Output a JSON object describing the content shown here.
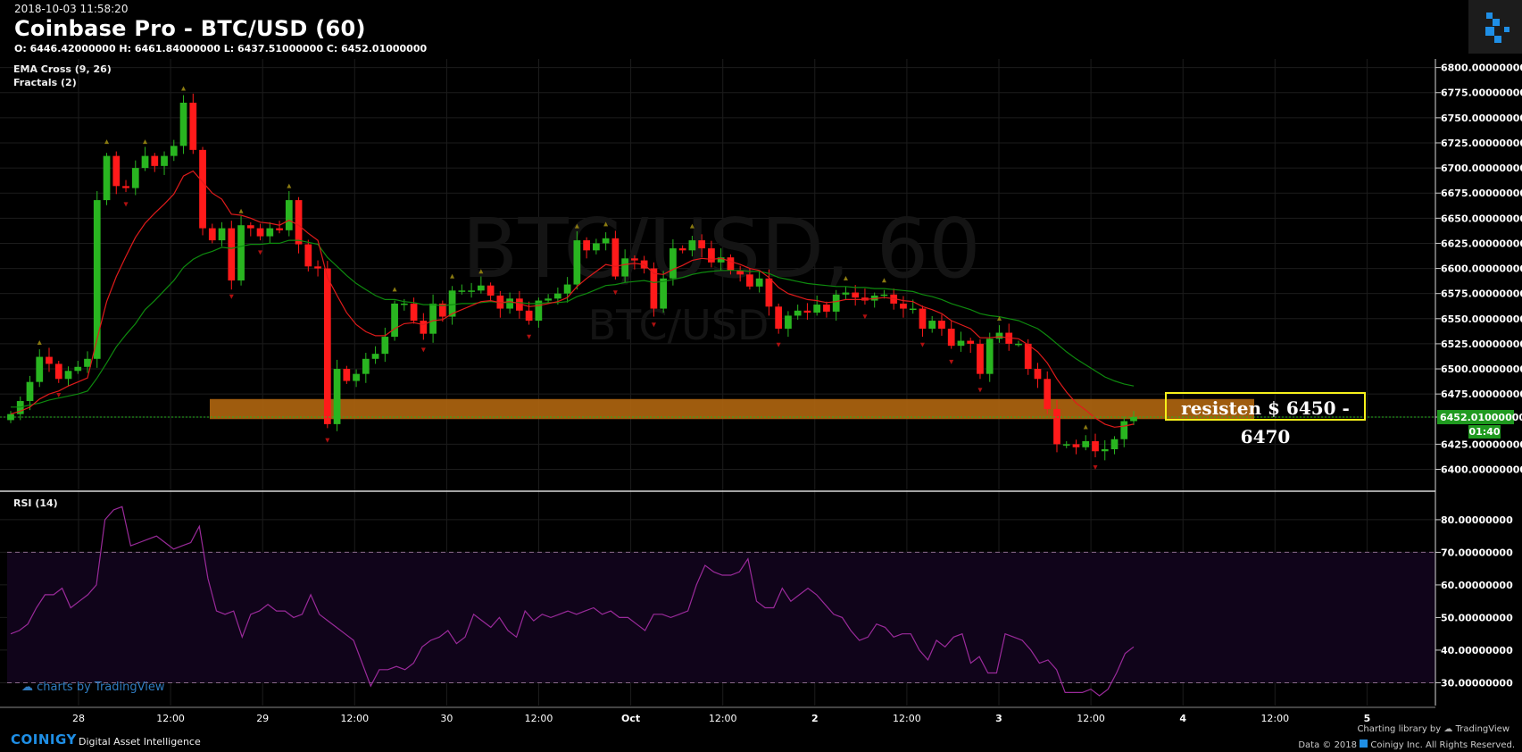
{
  "header": {
    "timestamp": "2018-10-03 11:58:20",
    "title": "Coinbase Pro - BTC/USD (60)",
    "ohlc": "O: 6446.42000000 H: 6461.84000000 L: 6437.51000000 C: 6452.01000000"
  },
  "indicators": {
    "ema": "EMA Cross (9, 26)",
    "fractals": "Fractals (2)",
    "rsi": "RSI (14)"
  },
  "watermark": {
    "symbol": "BTC/USD, 60",
    "sub": "BTC/USD",
    "tradingview": "charts by TradingView"
  },
  "annotation": {
    "text": "resisten $ 6450 - 6470",
    "zone": [
      6450,
      6470
    ]
  },
  "price_labels": {
    "last": "6452.01000000",
    "countdown": "01:40"
  },
  "footer": {
    "brand": "COINIGY",
    "tagline": "Digital Asset Intelligence",
    "credit_lib": "Charting library by",
    "credit_tv": "TradingView",
    "credit_data": "Data © 2018",
    "credit_inc": "Coinigy Inc. All Rights Reserved."
  },
  "colors": {
    "up": "#29b520",
    "down": "#ff1a1a",
    "ema_fast": "#e01b1b",
    "ema_slow": "#0e8a0e",
    "rsi": "#9a2a9a",
    "zone": "#b0660f",
    "annotation_border": "#f5ef1a"
  },
  "chart_data": [
    {
      "type": "candlestick",
      "title": "Coinbase Pro - BTC/USD (60)",
      "y_ticks": [
        "6800.00000000",
        "6775.00000000",
        "6750.00000000",
        "6725.00000000",
        "6700.00000000",
        "6675.00000000",
        "6650.00000000",
        "6625.00000000",
        "6600.00000000",
        "6575.00000000",
        "6550.00000000",
        "6525.00000000",
        "6500.00000000",
        "6475.00000000",
        "6452.01000000",
        "6425.00000000",
        "6400.00000000"
      ],
      "ylim": [
        6380,
        6805
      ],
      "x_ticks": [
        "28",
        "12:00",
        "29",
        "12:00",
        "30",
        "12:00",
        "Oct",
        "12:00",
        "2",
        "12:00",
        "3",
        "12:00",
        "4",
        "12:00",
        "5"
      ],
      "series_close": [
        6455,
        6468,
        6487,
        6512,
        6505,
        6490,
        6498,
        6502,
        6510,
        6668,
        6712,
        6682,
        6680,
        6700,
        6712,
        6702,
        6712,
        6722,
        6765,
        6718,
        6640,
        6628,
        6640,
        6588,
        6643,
        6640,
        6632,
        6640,
        6638,
        6668,
        6624,
        6602,
        6600,
        6445,
        6500,
        6488,
        6495,
        6510,
        6515,
        6532,
        6565,
        6565,
        6548,
        6535,
        6565,
        6552,
        6578,
        6578,
        6578,
        6583,
        6573,
        6560,
        6570,
        6558,
        6548,
        6568,
        6570,
        6575,
        6584,
        6628,
        6618,
        6625,
        6630,
        6592,
        6610,
        6608,
        6600,
        6560,
        6590,
        6620,
        6618,
        6628,
        6620,
        6606,
        6611,
        6598,
        6594,
        6582,
        6590,
        6562,
        6540,
        6553,
        6558,
        6556,
        6564,
        6557,
        6574,
        6576,
        6571,
        6568,
        6573,
        6574,
        6565,
        6560,
        6560,
        6540,
        6548,
        6540,
        6523,
        6528,
        6525,
        6495,
        6530,
        6536,
        6525,
        6525,
        6500,
        6490,
        6460,
        6425,
        6425,
        6422,
        6428,
        6418,
        6420,
        6430,
        6448,
        6452
      ],
      "ema_fast": [
        6455,
        6458,
        6462,
        6470,
        6475,
        6478,
        6483,
        6487,
        6491,
        6530,
        6567,
        6592,
        6612,
        6631,
        6645,
        6655,
        6664,
        6674,
        6692,
        6697,
        6686,
        6675,
        6669,
        6654,
        6653,
        6650,
        6646,
        6645,
        6643,
        6648,
        6643,
        6635,
        6628,
        6591,
        6573,
        6556,
        6544,
        6537,
        6533,
        6533,
        6540,
        6545,
        6546,
        6544,
        6548,
        6549,
        6555,
        6559,
        6563,
        6567,
        6568,
        6566,
        6567,
        6565,
        6562,
        6563,
        6565,
        6567,
        6571,
        6582,
        6590,
        6597,
        6604,
        6602,
        6604,
        6605,
        6604,
        6595,
        6594,
        6599,
        6603,
        6608,
        6610,
        6609,
        6610,
        6607,
        6604,
        6600,
        6598,
        6591,
        6581,
        6575,
        6572,
        6569,
        6568,
        6566,
        6567,
        6569,
        6569,
        6569,
        6570,
        6571,
        6570,
        6568,
        6567,
        6562,
        6559,
        6555,
        6548,
        6544,
        6540,
        6531,
        6531,
        6532,
        6531,
        6530,
        6524,
        6517,
        6506,
        6490,
        6477,
        6466,
        6459,
        6451,
        6445,
        6442,
        6443,
        6445
      ],
      "ema_slow": [
        6462,
        6462,
        6464,
        6466,
        6469,
        6471,
        6473,
        6475,
        6478,
        6491,
        6506,
        6522,
        6534,
        6545,
        6559,
        6568,
        6578,
        6588,
        6601,
        6609,
        6614,
        6617,
        6621,
        6620,
        6622,
        6624,
        6624,
        6625,
        6625,
        6628,
        6628,
        6626,
        6624,
        6611,
        6602,
        6593,
        6585,
        6579,
        6573,
        6569,
        6569,
        6567,
        6566,
        6564,
        6564,
        6563,
        6564,
        6565,
        6565,
        6566,
        6567,
        6566,
        6566,
        6566,
        6565,
        6565,
        6566,
        6566,
        6567,
        6572,
        6575,
        6579,
        6583,
        6584,
        6586,
        6587,
        6588,
        6586,
        6587,
        6589,
        6591,
        6594,
        6596,
        6597,
        6598,
        6598,
        6598,
        6597,
        6597,
        6595,
        6591,
        6589,
        6587,
        6585,
        6584,
        6583,
        6582,
        6582,
        6581,
        6581,
        6580,
        6580,
        6579,
        6578,
        6577,
        6574,
        6572,
        6569,
        6565,
        6562,
        6559,
        6555,
        6553,
        6552,
        6550,
        6548,
        6544,
        6540,
        6533,
        6525,
        6517,
        6510,
        6504,
        6498,
        6492,
        6488,
        6485,
        6483
      ]
    },
    {
      "type": "line",
      "title": "RSI (14)",
      "y_ticks": [
        "80.00000000",
        "70.00000000",
        "60.00000000",
        "50.00000000",
        "40.00000000",
        "30.00000000"
      ],
      "ylim": [
        23,
        86
      ],
      "bands": [
        30,
        70
      ],
      "values": [
        45,
        46,
        48,
        53,
        57,
        57,
        59,
        53,
        55,
        57,
        60,
        80,
        83,
        84,
        72,
        73,
        74,
        75,
        73,
        71,
        72,
        73,
        78,
        62,
        52,
        51,
        52,
        44,
        51,
        52,
        54,
        52,
        52,
        50,
        51,
        57,
        51,
        49,
        47,
        45,
        43,
        36,
        29,
        34,
        34,
        35,
        34,
        36,
        41,
        43,
        44,
        46,
        42,
        44,
        51,
        49,
        47,
        50,
        46,
        44,
        52,
        49,
        51,
        50,
        51,
        52,
        51,
        52,
        53,
        51,
        52,
        50,
        50,
        48,
        46,
        51,
        51,
        50,
        51,
        52,
        60,
        66,
        64,
        63,
        63,
        64,
        68,
        55,
        53,
        53,
        59,
        55,
        57,
        59,
        57,
        54,
        51,
        50,
        46,
        43,
        44,
        48,
        47,
        44,
        45,
        45,
        40,
        37,
        43,
        41,
        44,
        45,
        36,
        38,
        33,
        33,
        45,
        44,
        43,
        40,
        36,
        37,
        34,
        27,
        27,
        27,
        28,
        26,
        28,
        33,
        39,
        41
      ]
    }
  ]
}
